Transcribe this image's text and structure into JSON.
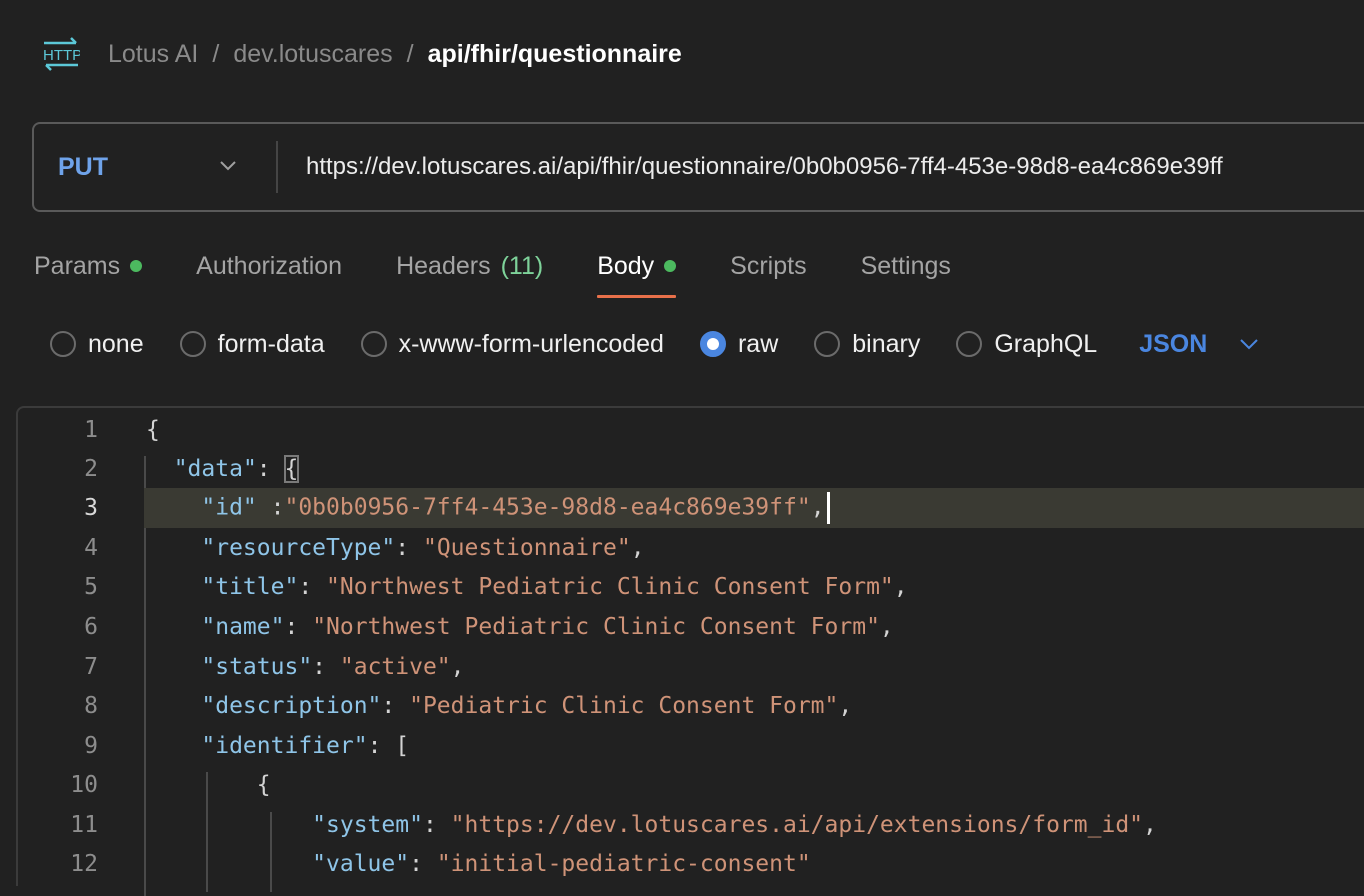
{
  "breadcrumb": {
    "icon": "http-icon",
    "items": [
      "Lotus AI",
      "dev.lotuscares",
      "api/fhir/questionnaire"
    ],
    "separator": "/"
  },
  "request": {
    "method": "PUT",
    "url": "https://dev.lotuscares.ai/api/fhir/questionnaire/0b0b0956-7ff4-453e-98d8-ea4c869e39ff",
    "method_color": "#6fa3ea"
  },
  "tabs": [
    {
      "label": "Params",
      "dot": true
    },
    {
      "label": "Authorization"
    },
    {
      "label": "Headers",
      "count": "(11)"
    },
    {
      "label": "Body",
      "dot": true,
      "active": true
    },
    {
      "label": "Scripts"
    },
    {
      "label": "Settings"
    }
  ],
  "body_types": {
    "options": [
      "none",
      "form-data",
      "x-www-form-urlencoded",
      "raw",
      "binary",
      "GraphQL"
    ],
    "selected": "raw",
    "language": "JSON"
  },
  "editor": {
    "current_line": 3,
    "lines": [
      {
        "n": "1"
      },
      {
        "n": "2",
        "key": "\"data\""
      },
      {
        "n": "3",
        "key": "\"id\"",
        "value": "\"0b0b0956-7ff4-453e-98d8-ea4c869e39ff\""
      },
      {
        "n": "4",
        "key": "\"resourceType\"",
        "value": "\"Questionnaire\""
      },
      {
        "n": "5",
        "key": "\"title\"",
        "value": "\"Northwest Pediatric Clinic Consent Form\""
      },
      {
        "n": "6",
        "key": "\"name\"",
        "value": "\"Northwest Pediatric Clinic Consent Form\""
      },
      {
        "n": "7",
        "key": "\"status\"",
        "value": "\"active\""
      },
      {
        "n": "8",
        "key": "\"description\"",
        "value": "\"Pediatric Clinic Consent Form\""
      },
      {
        "n": "9",
        "key": "\"identifier\""
      },
      {
        "n": "10"
      },
      {
        "n": "11",
        "key": "\"system\"",
        "value": "\"https://dev.lotuscares.ai/api/extensions/form_id\""
      },
      {
        "n": "12",
        "key": "\"value\"",
        "value": "\"initial-pediatric-consent\""
      }
    ]
  },
  "colors": {
    "accent_tab": "#e8704a",
    "dot": "#4cba5f",
    "json_key": "#8fc5e8",
    "json_string": "#cf9378"
  }
}
